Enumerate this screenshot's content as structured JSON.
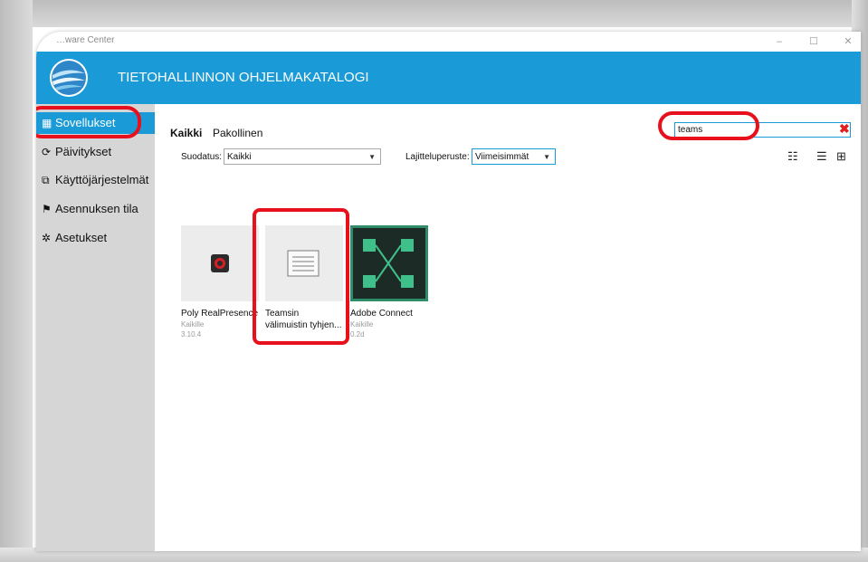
{
  "window": {
    "title": "…ware Center",
    "controls": {
      "minimize": "–",
      "maximize": "☐",
      "close": "✕"
    }
  },
  "banner": {
    "title": "TIETOHALLINNON OHJELMAKATALOGI"
  },
  "sidebar": {
    "items": [
      {
        "label": "Sovellukset",
        "icon": "grid-icon",
        "glyph": "▦",
        "active": true
      },
      {
        "label": "Päivitykset",
        "icon": "refresh-icon",
        "glyph": "⟳",
        "active": false
      },
      {
        "label": "Käyttöjärjestelmät",
        "icon": "os-window-icon",
        "glyph": "⧉",
        "active": false
      },
      {
        "label": "Asennuksen tila",
        "icon": "flag-icon",
        "glyph": "⚑",
        "active": false
      },
      {
        "label": "Asetukset",
        "icon": "gear-icon",
        "glyph": "✲",
        "active": false
      }
    ]
  },
  "tabs": {
    "all": "Kaikki",
    "required": "Pakollinen"
  },
  "filters": {
    "filter_label": "Suodatus:",
    "filter_value": "Kaikki",
    "sort_label": "Lajitteluperuste:",
    "sort_value": "Viimeisimmät"
  },
  "search": {
    "value": "teams",
    "clear_glyph": "✖"
  },
  "view_icons": [
    {
      "name": "checklist-view-icon",
      "glyph": "☷"
    },
    {
      "name": "list-view-icon",
      "glyph": "☰"
    },
    {
      "name": "tile-view-icon",
      "glyph": "⊞"
    }
  ],
  "apps": [
    {
      "name": "Poly RealPresence",
      "publisher": "Kaikille",
      "version": "3.10.4"
    },
    {
      "name": "Teamsin",
      "name_line2": "välimuistin tyhjen...",
      "publisher": "",
      "version": ""
    },
    {
      "name": "Adobe Connect",
      "publisher": "Kaikille",
      "version": "0.2d"
    }
  ],
  "colors": {
    "accent": "#1a9ad6",
    "annotation": "#e8101c",
    "sidebar": "#d6d6d6"
  }
}
